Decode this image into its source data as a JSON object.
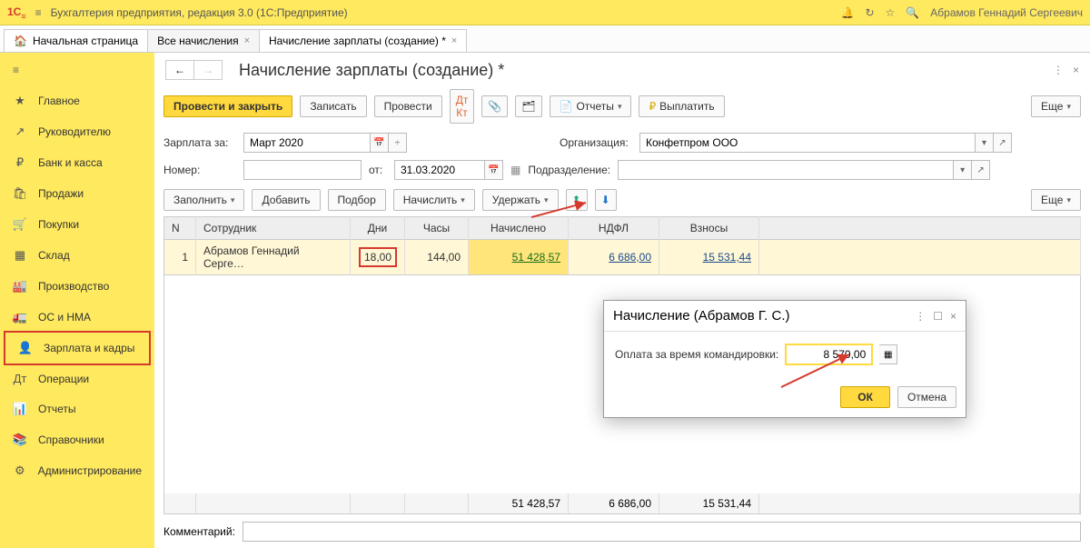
{
  "titlebar": {
    "logo": "1С",
    "title": "Бухгалтерия предприятия, редакция 3.0  (1С:Предприятие)",
    "user": "Абрамов Геннадий Сергеевич"
  },
  "tabs": {
    "home": "Начальная страница",
    "t1": "Все начисления",
    "t2": "Начисление зарплаты (создание) *"
  },
  "sidebar": [
    {
      "icon": "★",
      "label": "Главное"
    },
    {
      "icon": "↗",
      "label": "Руководителю"
    },
    {
      "icon": "₽",
      "label": "Банк и касса"
    },
    {
      "icon": "🛍",
      "label": "Продажи"
    },
    {
      "icon": "🛒",
      "label": "Покупки"
    },
    {
      "icon": "▦",
      "label": "Склад"
    },
    {
      "icon": "🏭",
      "label": "Производство"
    },
    {
      "icon": "🚛",
      "label": "ОС и НМА"
    },
    {
      "icon": "👤",
      "label": "Зарплата и кадры",
      "selected": true
    },
    {
      "icon": "Дт",
      "label": "Операции"
    },
    {
      "icon": "📊",
      "label": "Отчеты"
    },
    {
      "icon": "📚",
      "label": "Справочники"
    },
    {
      "icon": "⚙",
      "label": "Администрирование"
    }
  ],
  "page": {
    "title": "Начисление зарплаты (создание) *"
  },
  "cmd": {
    "post_close": "Провести и закрыть",
    "save": "Записать",
    "post": "Провести",
    "reports": "Отчеты",
    "pay": "Выплатить",
    "more": "Еще"
  },
  "form": {
    "salary_for": "Зарплата за:",
    "month": "Март 2020",
    "org_label": "Организация:",
    "org": "Конфетпром ООО",
    "number_label": "Номер:",
    "from_label": "от:",
    "date": "31.03.2020",
    "dept_label": "Подразделение:"
  },
  "tb": {
    "fill": "Заполнить",
    "add": "Добавить",
    "pick": "Подбор",
    "accrue": "Начислить",
    "deduct": "Удержать",
    "more": "Еще"
  },
  "table": {
    "h_n": "N",
    "h_emp": "Сотрудник",
    "h_days": "Дни",
    "h_hours": "Часы",
    "h_accrued": "Начислено",
    "h_tax": "НДФЛ",
    "h_contrib": "Взносы",
    "r1": {
      "n": "1",
      "emp": "Абрамов Геннадий Серге…",
      "days": "18,00",
      "hours": "144,00",
      "accrued": "51 428,57",
      "tax": "6 686,00",
      "contrib": "15 531,44"
    }
  },
  "totals": {
    "accrued": "51 428,57",
    "tax": "6 686,00",
    "contrib": "15 531,44"
  },
  "comment_label": "Комментарий:",
  "dialog": {
    "title": "Начисление (Абрамов Г. С.)",
    "field": "Оплата за время командировки:",
    "value": "8 570,00",
    "ok": "ОК",
    "cancel": "Отмена"
  }
}
